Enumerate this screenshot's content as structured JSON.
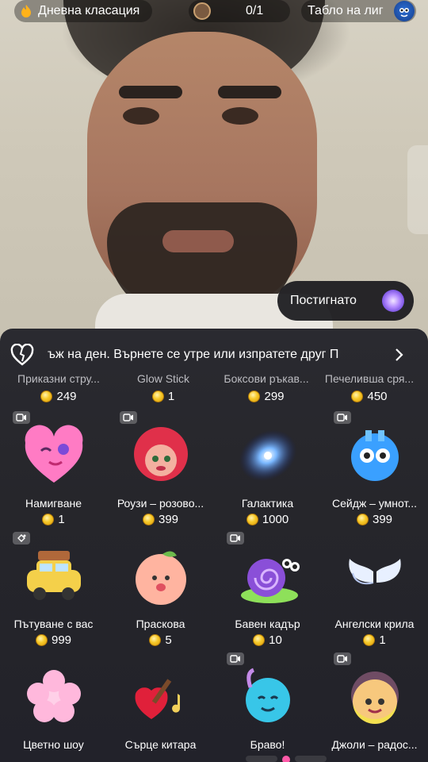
{
  "topbar": {
    "rank_label": "Дневна класация",
    "goal_count": "0/1",
    "league_label": "Табло на лиг"
  },
  "achieved": {
    "label": "Постигнато"
  },
  "panel": {
    "marquee": "ъж на ден. Върнете се утре или изпратете друг П",
    "prev_row": [
      {
        "name": "Приказни стру...",
        "price": "249"
      },
      {
        "name": "Glow Stick",
        "price": "1"
      },
      {
        "name": "Боксови ръкав...",
        "price": "299"
      },
      {
        "name": "Печелившa сря...",
        "price": "450"
      }
    ],
    "gifts": [
      {
        "name": "Намигване",
        "price": "1",
        "badge": "video",
        "icon": "heart-wink-icon"
      },
      {
        "name": "Роузи – розово...",
        "price": "399",
        "badge": "video",
        "icon": "rosie-icon"
      },
      {
        "name": "Галактика",
        "price": "1000",
        "badge": "",
        "icon": "galaxy-icon"
      },
      {
        "name": "Сейдж – умнот...",
        "price": "399",
        "badge": "video",
        "icon": "sage-icon"
      },
      {
        "name": "Пътуване с вас",
        "price": "999",
        "badge": "interactive",
        "icon": "car-trip-icon"
      },
      {
        "name": "Праскова",
        "price": "5",
        "badge": "",
        "icon": "peach-icon"
      },
      {
        "name": "Бавен кадър",
        "price": "10",
        "badge": "video",
        "icon": "snail-icon"
      },
      {
        "name": "Ангелски крила",
        "price": "1",
        "badge": "",
        "icon": "angel-wings-icon"
      },
      {
        "name": "Цветно шоу",
        "price": "",
        "badge": "",
        "icon": "flower-show-icon"
      },
      {
        "name": "Сърце китара",
        "price": "",
        "badge": "",
        "icon": "heart-guitar-icon"
      },
      {
        "name": "Браво!",
        "price": "",
        "badge": "video",
        "icon": "bravo-icon"
      },
      {
        "name": "Джоли – радос...",
        "price": "",
        "badge": "video",
        "icon": "jolly-icon"
      }
    ]
  },
  "colors": {
    "coin": "#f7c928",
    "panel_bg": "#26262b",
    "accent_pink": "#ff5aa8"
  }
}
